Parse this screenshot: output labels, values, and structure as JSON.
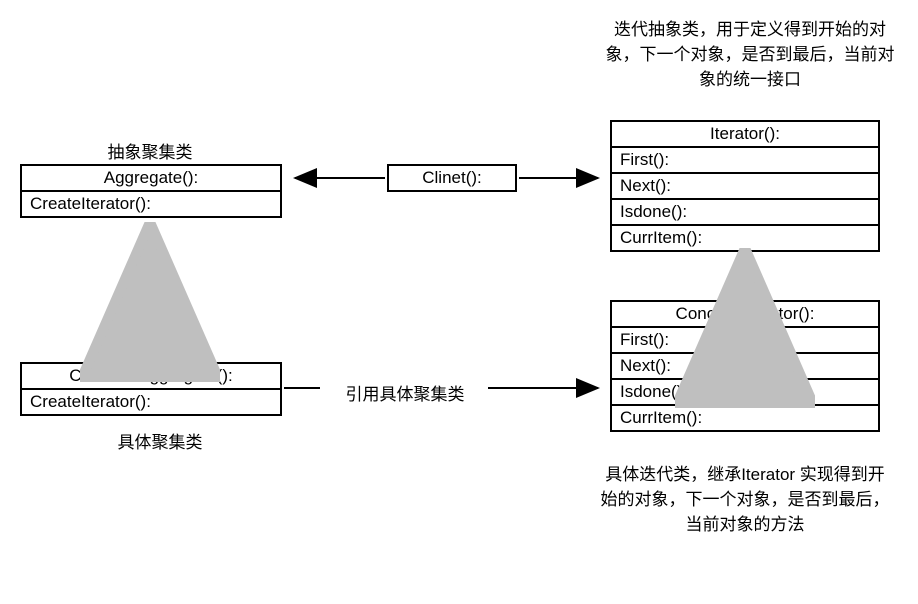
{
  "annotations": {
    "topRight": "迭代抽象类，用于定义得到开始的对象，下一个对象，是否到最后，当前对象的统一接口",
    "topLeft": "抽象聚集类",
    "bottomLeft": "具体聚集类",
    "bottomRight": "具体迭代类，继承Iterator 实现得到开始的对象，下一个对象，是否到最后，当前对象的方法",
    "middleArrow": "引用具体聚集类"
  },
  "boxes": {
    "aggregate": {
      "title": "Aggregate():",
      "methods": [
        "CreateIterator():"
      ]
    },
    "client": {
      "title": "Clinet():"
    },
    "iterator": {
      "title": "Iterator():",
      "methods": [
        "First():",
        "Next():",
        "Isdone():",
        "CurrItem():"
      ]
    },
    "concreteAggregate": {
      "title": "ConcreteAggregate():",
      "methods": [
        "CreateIterator():"
      ]
    },
    "concreteIterator": {
      "title": "ConcreteIterator():",
      "methods": [
        "First():",
        "Next():",
        "Isdone():",
        "CurrItem():"
      ]
    }
  }
}
